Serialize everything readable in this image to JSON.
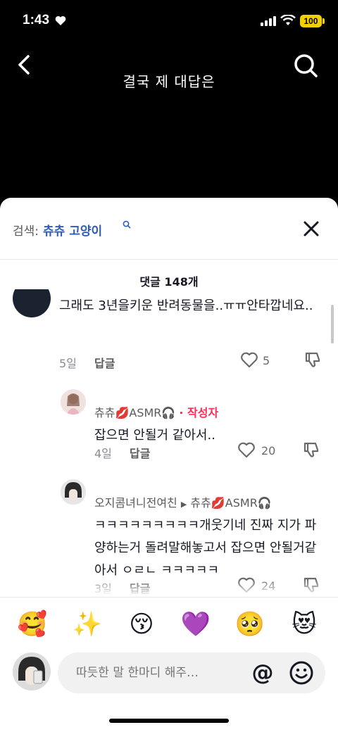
{
  "status": {
    "time": "1:43",
    "battery": "100"
  },
  "video": {
    "caption": "결국 제 대답은"
  },
  "search": {
    "prefix": "검색:",
    "query": "츄츄 고양이"
  },
  "comments_header": {
    "count_label": "댓글 148개"
  },
  "comments": [
    {
      "text": "그래도 3년을키운 반려동물을..ㅠㅠ안타깝네요..",
      "date": "5일",
      "reply_label": "답글",
      "likes": "5"
    },
    {
      "user": "츄츄💋ASMR🎧",
      "author_tag": "· 작성자",
      "text": "잡으면 안될거 같아서..",
      "date": "4일",
      "reply_label": "답글",
      "likes": "20"
    },
    {
      "user": "오지콤녀니전여친",
      "reply_to": "츄츄💋ASMR🎧",
      "text": "ㅋㅋㅋㅋㅋㅋㅋㅋㅋ개웃기네 진짜 지가 파양하는거 돌려말해놓고서 잡으면 안될거같아서 ㅇㄹㄴ ㅋㅋㅋㅋㅋ",
      "date": "3일",
      "reply_label": "답글",
      "likes": "24"
    }
  ],
  "emoji_bar": [
    "🥰",
    "✨",
    "😚",
    "💜",
    "🥺",
    "😻"
  ],
  "composer": {
    "placeholder": "따듯한 말 한마디 해주…",
    "at_label": "@"
  },
  "colors": {
    "author_tag": "#ff2c55",
    "search_query": "#2c5db8",
    "battery": "#f5d000"
  }
}
